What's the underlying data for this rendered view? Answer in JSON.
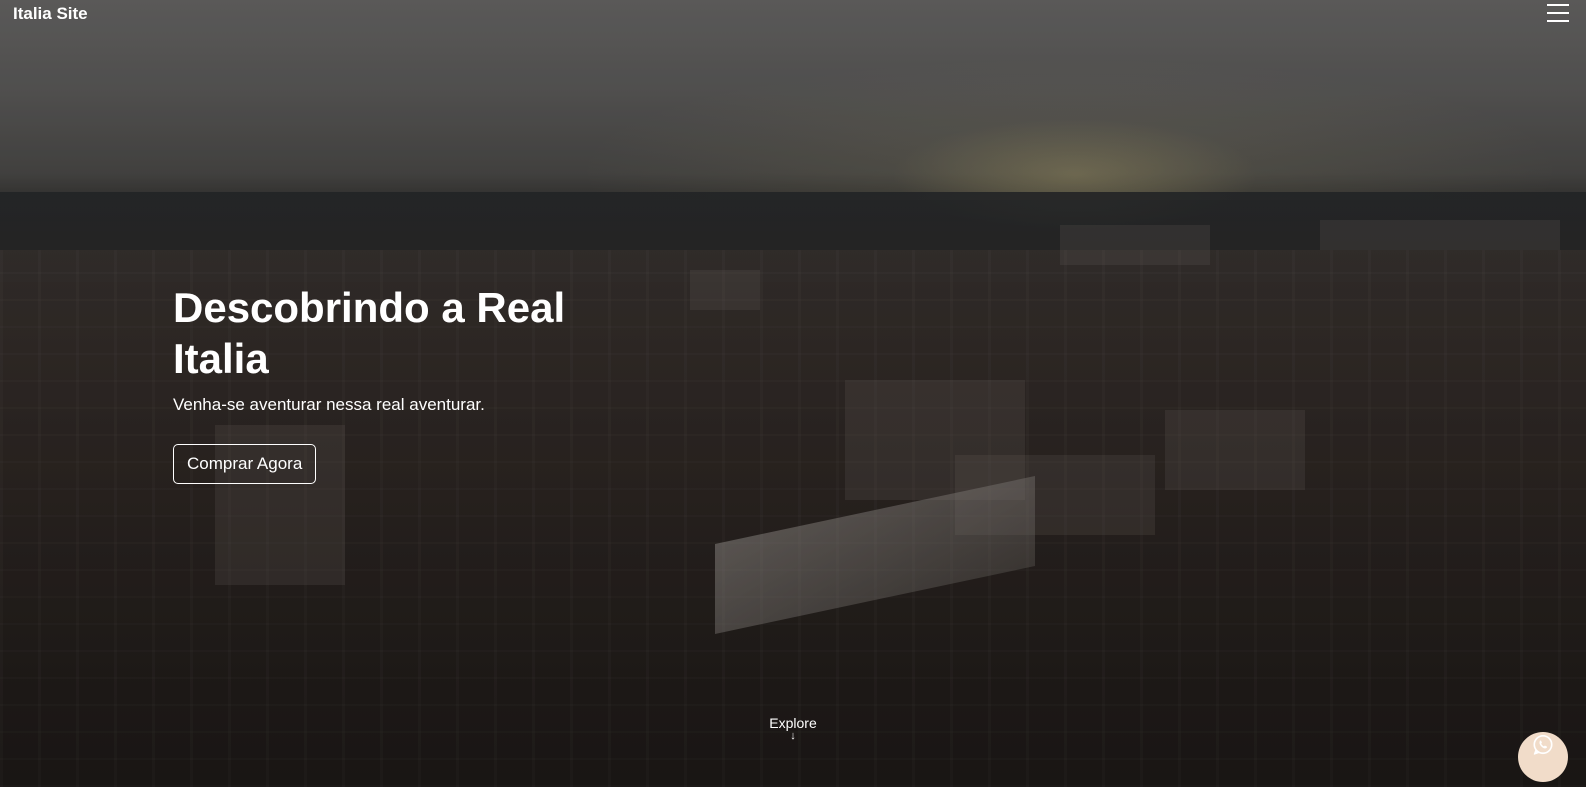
{
  "nav": {
    "brand": "Italia Site",
    "menu_icon": "hamburger-menu-icon"
  },
  "hero": {
    "title": "Descobrindo a Real Italia",
    "subtitle": "Venha-se aventurar nessa real aventurar.",
    "cta_label": "Comprar Agora"
  },
  "explore": {
    "label": "Explore",
    "arrow": "↓",
    "icon": "arrow-down-icon"
  },
  "whatsapp": {
    "icon": "whatsapp-icon",
    "background": "#f1dcc9"
  }
}
